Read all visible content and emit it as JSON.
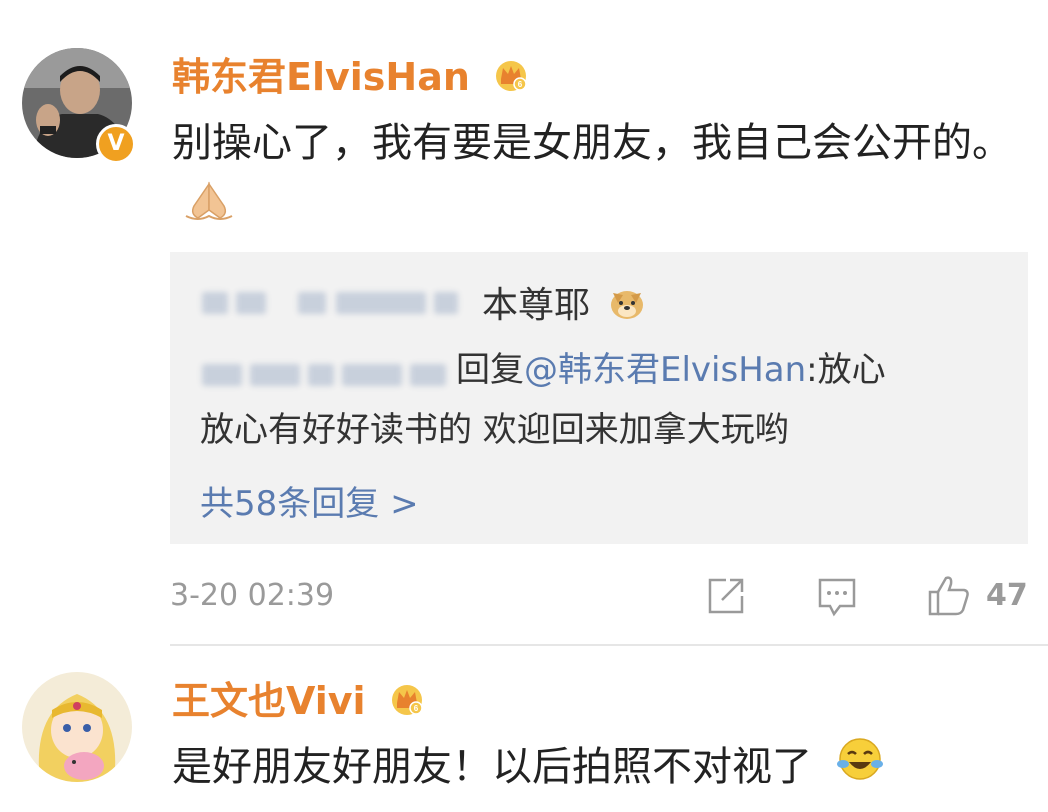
{
  "comments": [
    {
      "username": "韩东君ElvisHan",
      "verified_badge": "V",
      "badge_icon": "vip-crown-icon",
      "text": "别操心了，我有要是女朋友，我自己会公开的。",
      "emoji": "folded-hands-emoji",
      "reply": {
        "name": "本尊耶",
        "name_emoji": "doge-emoji",
        "reply_prefix": "回复",
        "mention": "@韩东君ElvisHan",
        "reply_text_line1": ":放心",
        "reply_text_line2": "放心有好好读书的 欢迎回来加拿大玩哟",
        "more_label": "共58条回复 >"
      },
      "timestamp": "3-20 02:39",
      "actions": {
        "share_icon": "share-icon",
        "comment_icon": "comment-icon",
        "like_icon": "thumbs-up-icon",
        "like_count": "47"
      }
    },
    {
      "username": "王文也Vivi",
      "badge_icon": "vip-crown-icon",
      "text": "是好朋友好朋友！以后拍照不对视了",
      "emoji": "laughing-tears-emoji"
    }
  ]
}
